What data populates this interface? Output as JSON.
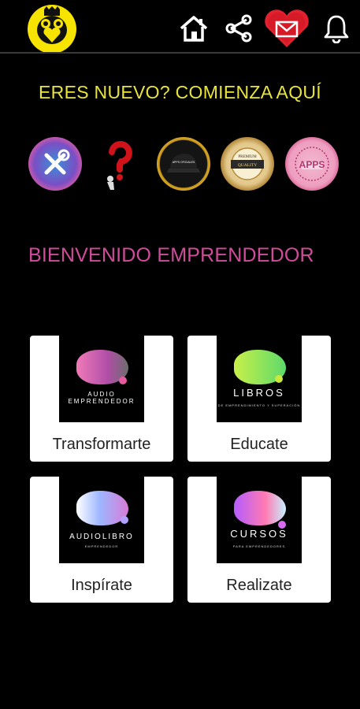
{
  "header": {
    "logo": "emprendedor-logo",
    "icons": [
      "home-icon",
      "share-icon",
      "mail-heart-icon",
      "bell-icon"
    ]
  },
  "headline": "ERES NUEVO? COMIENZA AQUÍ",
  "circle_buttons": [
    {
      "icon": "tools-icon"
    },
    {
      "icon": "question-icon"
    },
    {
      "icon": "cap-icon",
      "text": "APPS OFICIALES"
    },
    {
      "icon": "quality-badge-icon",
      "text1": "PREMIUM",
      "text2": "QUALITY"
    },
    {
      "icon": "apps-stamp-icon",
      "text": "APPS"
    }
  ],
  "welcome": "BIENVENIDO EMPRENDEDOR",
  "cards": [
    {
      "label": "Transformarte",
      "title": "AUDIO",
      "title2": "EMPRENDEDOR",
      "sub": "",
      "colors": [
        "#f07ab8",
        "#e85aa0"
      ]
    },
    {
      "label": "Educate",
      "title": "LIBROS",
      "title2": "",
      "sub": "DE EMPRENDIMIENTO Y SUPERACIÓN",
      "colors": [
        "#c8f04a",
        "#5ed96a"
      ]
    },
    {
      "label": "Inspírate",
      "title": "AUDIOLIBRO",
      "title2": "",
      "sub": "EMPRENDEDOR",
      "colors": [
        "#8fc7ff",
        "#d97ad6"
      ]
    },
    {
      "label": "Realizate",
      "title": "CURSOS",
      "title2": "",
      "sub": "PARA EMPRENDEDORES",
      "colors": [
        "#b35cff",
        "#ff7ab2"
      ]
    }
  ]
}
